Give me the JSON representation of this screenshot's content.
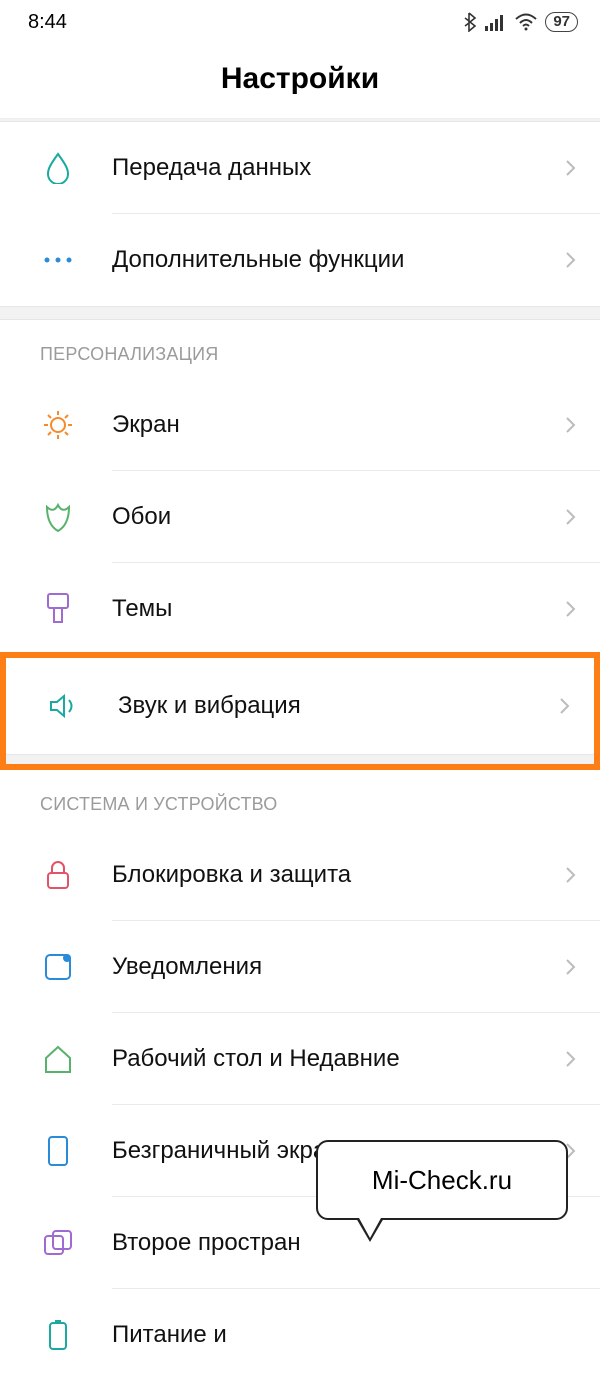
{
  "status": {
    "time": "8:44",
    "battery": "97"
  },
  "header": {
    "title": "Настройки"
  },
  "top_items": [
    {
      "label": "Передача данных",
      "icon": "droplet-icon"
    },
    {
      "label": "Дополнительные функции",
      "icon": "more-icon"
    }
  ],
  "sections": [
    {
      "title": "ПЕРСОНАЛИЗАЦИЯ",
      "items": [
        {
          "label": "Экран",
          "icon": "sun-icon"
        },
        {
          "label": "Обои",
          "icon": "flower-icon"
        },
        {
          "label": "Темы",
          "icon": "brush-icon"
        },
        {
          "label": "Звук и вибрация",
          "icon": "sound-icon",
          "highlighted": true
        }
      ]
    },
    {
      "title": "СИСТЕМА И УСТРОЙСТВО",
      "items": [
        {
          "label": "Блокировка и защита",
          "icon": "lock-icon"
        },
        {
          "label": "Уведомления",
          "icon": "notification-icon"
        },
        {
          "label": "Рабочий стол и Недавние",
          "icon": "home-icon"
        },
        {
          "label": "Безграничный экран",
          "icon": "fullscreen-icon"
        },
        {
          "label": "Второе простран",
          "icon": "spaces-icon"
        },
        {
          "label": "Питание и",
          "icon": "battery-icon"
        }
      ]
    }
  ],
  "callout": {
    "text": "Mi-Check.ru"
  },
  "colors": {
    "highlight": "#fd7e14",
    "teal": "#1aa9a0",
    "orange": "#f78b2a",
    "green": "#57b36b",
    "purple": "#a06bd1",
    "red": "#e4526a",
    "blue": "#2a8bd8"
  }
}
